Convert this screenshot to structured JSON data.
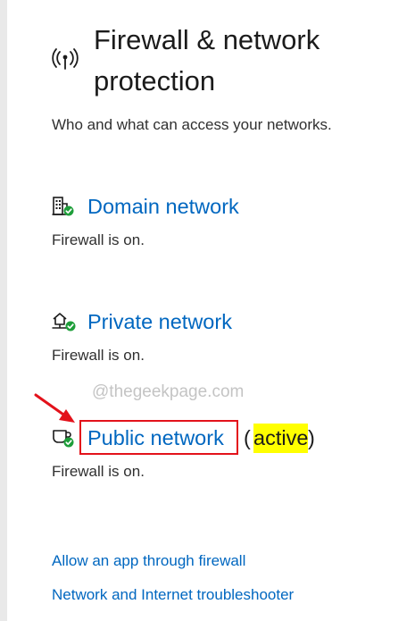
{
  "header": {
    "title_line1": "Firewall & network",
    "title_line2": "protection",
    "subtitle": "Who and what can access your networks."
  },
  "icons": {
    "header": "wifi-broadcast-icon",
    "domain": "building-shield-icon",
    "private": "house-network-shield-icon",
    "public": "coffee-cup-shield-icon",
    "arrow": "red-arrow-icon"
  },
  "networks": {
    "domain": {
      "label": "Domain network",
      "status": "Firewall is on."
    },
    "private": {
      "label": "Private network",
      "status": "Firewall is on."
    },
    "public": {
      "label": "Public network",
      "status": "Firewall is on.",
      "paren_open": "(",
      "active": "active",
      "paren_close": ")"
    }
  },
  "watermark": "@thegeekpage.com",
  "links": {
    "allow_app": "Allow an app through firewall",
    "troubleshooter": "Network and Internet troubleshooter"
  },
  "colors": {
    "accent": "#0067c0",
    "shield_ok": "#1e9e3a",
    "highlight": "#ffff00",
    "annotation": "#e3121b"
  }
}
